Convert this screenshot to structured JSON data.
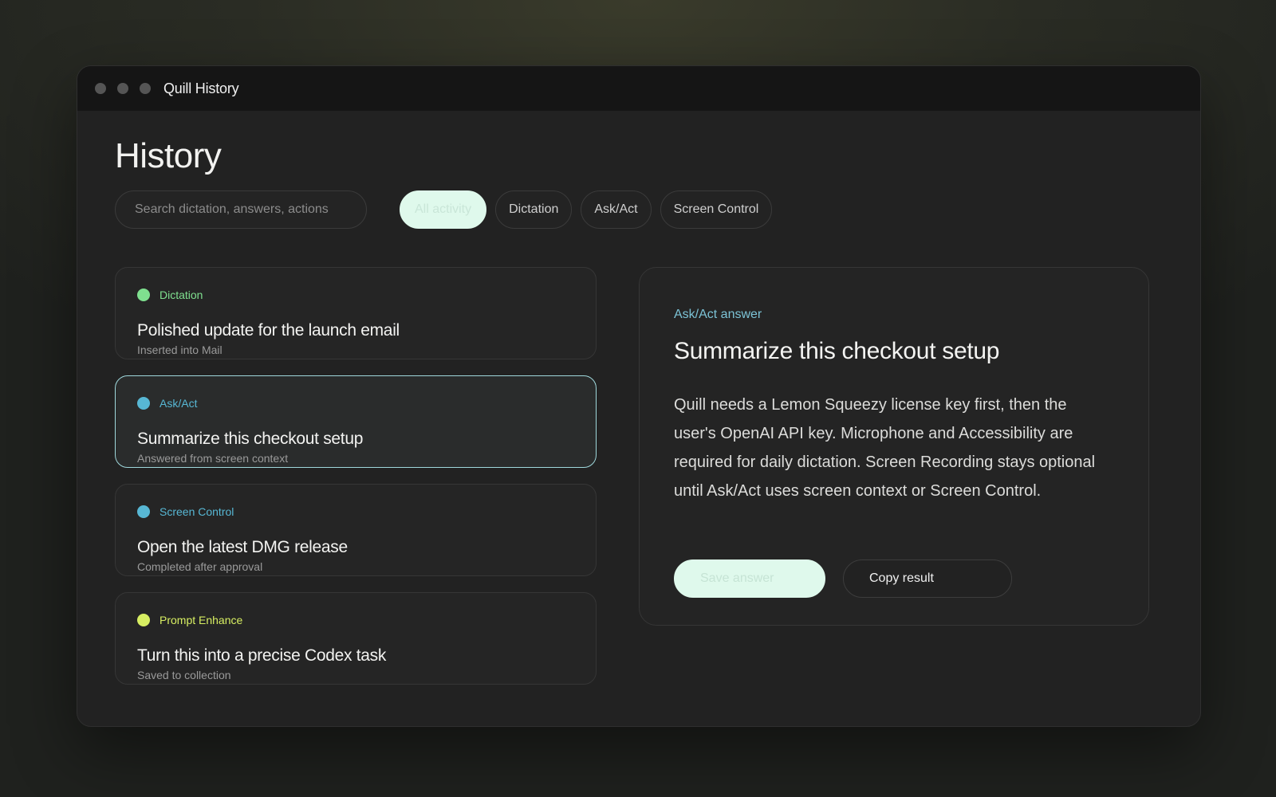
{
  "window": {
    "title": "Quill History"
  },
  "page": {
    "title": "History"
  },
  "search": {
    "placeholder": "Search dictation, answers, actions",
    "value": ""
  },
  "filters": [
    {
      "label": "All activity",
      "active": true
    },
    {
      "label": "Dictation",
      "active": false
    },
    {
      "label": "Ask/Act",
      "active": false
    },
    {
      "label": "Screen Control",
      "active": false
    }
  ],
  "history": [
    {
      "category": "Dictation",
      "title": "Polished update for the launch email",
      "subtitle": "Inserted into Mail",
      "color": "#7fe08f",
      "selected": false
    },
    {
      "category": "Ask/Act",
      "title": "Summarize this checkout setup",
      "subtitle": "Answered from screen context",
      "color": "#57b7d4",
      "selected": true
    },
    {
      "category": "Screen Control",
      "title": "Open the latest DMG release",
      "subtitle": "Completed after approval",
      "color": "#57b7d4",
      "selected": false
    },
    {
      "category": "Prompt Enhance",
      "title": "Turn this into a precise Codex task",
      "subtitle": "Saved to collection",
      "color": "#d7ee62",
      "selected": false
    }
  ],
  "detail": {
    "kicker": "Ask/Act answer",
    "title": "Summarize this checkout setup",
    "body": "Quill needs a Lemon Squeezy license key first, then the user's OpenAI API key. Microphone and Accessibility are required for daily dictation. Screen Recording stays optional until Ask/Act uses screen context or Screen Control.",
    "primary_button": "Save answer",
    "secondary_button": "Copy result"
  },
  "colors": {
    "accent": "#dff9ec",
    "selected_border": "#9fd8dc",
    "dictation": "#7fe08f",
    "ask_act": "#57b7d4",
    "screen_control": "#57b7d4",
    "prompt_enhance": "#d7ee62"
  }
}
